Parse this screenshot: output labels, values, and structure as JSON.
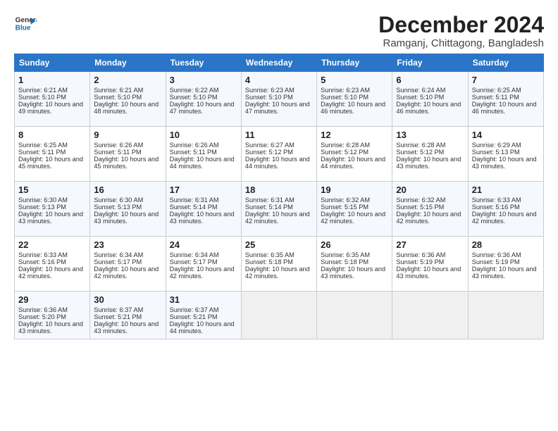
{
  "logo": {
    "line1": "General",
    "line2": "Blue"
  },
  "title": "December 2024",
  "location": "Ramganj, Chittagong, Bangladesh",
  "weekdays": [
    "Sunday",
    "Monday",
    "Tuesday",
    "Wednesday",
    "Thursday",
    "Friday",
    "Saturday"
  ],
  "weeks": [
    [
      {
        "day": "1",
        "sunrise": "Sunrise: 6:21 AM",
        "sunset": "Sunset: 5:10 PM",
        "daylight": "Daylight: 10 hours and 49 minutes."
      },
      {
        "day": "2",
        "sunrise": "Sunrise: 6:21 AM",
        "sunset": "Sunset: 5:10 PM",
        "daylight": "Daylight: 10 hours and 48 minutes."
      },
      {
        "day": "3",
        "sunrise": "Sunrise: 6:22 AM",
        "sunset": "Sunset: 5:10 PM",
        "daylight": "Daylight: 10 hours and 47 minutes."
      },
      {
        "day": "4",
        "sunrise": "Sunrise: 6:23 AM",
        "sunset": "Sunset: 5:10 PM",
        "daylight": "Daylight: 10 hours and 47 minutes."
      },
      {
        "day": "5",
        "sunrise": "Sunrise: 6:23 AM",
        "sunset": "Sunset: 5:10 PM",
        "daylight": "Daylight: 10 hours and 46 minutes."
      },
      {
        "day": "6",
        "sunrise": "Sunrise: 6:24 AM",
        "sunset": "Sunset: 5:10 PM",
        "daylight": "Daylight: 10 hours and 46 minutes."
      },
      {
        "day": "7",
        "sunrise": "Sunrise: 6:25 AM",
        "sunset": "Sunset: 5:11 PM",
        "daylight": "Daylight: 10 hours and 46 minutes."
      }
    ],
    [
      {
        "day": "8",
        "sunrise": "Sunrise: 6:25 AM",
        "sunset": "Sunset: 5:11 PM",
        "daylight": "Daylight: 10 hours and 45 minutes."
      },
      {
        "day": "9",
        "sunrise": "Sunrise: 6:26 AM",
        "sunset": "Sunset: 5:11 PM",
        "daylight": "Daylight: 10 hours and 45 minutes."
      },
      {
        "day": "10",
        "sunrise": "Sunrise: 6:26 AM",
        "sunset": "Sunset: 5:11 PM",
        "daylight": "Daylight: 10 hours and 44 minutes."
      },
      {
        "day": "11",
        "sunrise": "Sunrise: 6:27 AM",
        "sunset": "Sunset: 5:12 PM",
        "daylight": "Daylight: 10 hours and 44 minutes."
      },
      {
        "day": "12",
        "sunrise": "Sunrise: 6:28 AM",
        "sunset": "Sunset: 5:12 PM",
        "daylight": "Daylight: 10 hours and 44 minutes."
      },
      {
        "day": "13",
        "sunrise": "Sunrise: 6:28 AM",
        "sunset": "Sunset: 5:12 PM",
        "daylight": "Daylight: 10 hours and 43 minutes."
      },
      {
        "day": "14",
        "sunrise": "Sunrise: 6:29 AM",
        "sunset": "Sunset: 5:13 PM",
        "daylight": "Daylight: 10 hours and 43 minutes."
      }
    ],
    [
      {
        "day": "15",
        "sunrise": "Sunrise: 6:30 AM",
        "sunset": "Sunset: 5:13 PM",
        "daylight": "Daylight: 10 hours and 43 minutes."
      },
      {
        "day": "16",
        "sunrise": "Sunrise: 6:30 AM",
        "sunset": "Sunset: 5:13 PM",
        "daylight": "Daylight: 10 hours and 43 minutes."
      },
      {
        "day": "17",
        "sunrise": "Sunrise: 6:31 AM",
        "sunset": "Sunset: 5:14 PM",
        "daylight": "Daylight: 10 hours and 43 minutes."
      },
      {
        "day": "18",
        "sunrise": "Sunrise: 6:31 AM",
        "sunset": "Sunset: 5:14 PM",
        "daylight": "Daylight: 10 hours and 42 minutes."
      },
      {
        "day": "19",
        "sunrise": "Sunrise: 6:32 AM",
        "sunset": "Sunset: 5:15 PM",
        "daylight": "Daylight: 10 hours and 42 minutes."
      },
      {
        "day": "20",
        "sunrise": "Sunrise: 6:32 AM",
        "sunset": "Sunset: 5:15 PM",
        "daylight": "Daylight: 10 hours and 42 minutes."
      },
      {
        "day": "21",
        "sunrise": "Sunrise: 6:33 AM",
        "sunset": "Sunset: 5:16 PM",
        "daylight": "Daylight: 10 hours and 42 minutes."
      }
    ],
    [
      {
        "day": "22",
        "sunrise": "Sunrise: 6:33 AM",
        "sunset": "Sunset: 5:16 PM",
        "daylight": "Daylight: 10 hours and 42 minutes."
      },
      {
        "day": "23",
        "sunrise": "Sunrise: 6:34 AM",
        "sunset": "Sunset: 5:17 PM",
        "daylight": "Daylight: 10 hours and 42 minutes."
      },
      {
        "day": "24",
        "sunrise": "Sunrise: 6:34 AM",
        "sunset": "Sunset: 5:17 PM",
        "daylight": "Daylight: 10 hours and 42 minutes."
      },
      {
        "day": "25",
        "sunrise": "Sunrise: 6:35 AM",
        "sunset": "Sunset: 5:18 PM",
        "daylight": "Daylight: 10 hours and 42 minutes."
      },
      {
        "day": "26",
        "sunrise": "Sunrise: 6:35 AM",
        "sunset": "Sunset: 5:18 PM",
        "daylight": "Daylight: 10 hours and 43 minutes."
      },
      {
        "day": "27",
        "sunrise": "Sunrise: 6:36 AM",
        "sunset": "Sunset: 5:19 PM",
        "daylight": "Daylight: 10 hours and 43 minutes."
      },
      {
        "day": "28",
        "sunrise": "Sunrise: 6:36 AM",
        "sunset": "Sunset: 5:19 PM",
        "daylight": "Daylight: 10 hours and 43 minutes."
      }
    ],
    [
      {
        "day": "29",
        "sunrise": "Sunrise: 6:36 AM",
        "sunset": "Sunset: 5:20 PM",
        "daylight": "Daylight: 10 hours and 43 minutes."
      },
      {
        "day": "30",
        "sunrise": "Sunrise: 6:37 AM",
        "sunset": "Sunset: 5:21 PM",
        "daylight": "Daylight: 10 hours and 43 minutes."
      },
      {
        "day": "31",
        "sunrise": "Sunrise: 6:37 AM",
        "sunset": "Sunset: 5:21 PM",
        "daylight": "Daylight: 10 hours and 44 minutes."
      },
      null,
      null,
      null,
      null
    ]
  ]
}
